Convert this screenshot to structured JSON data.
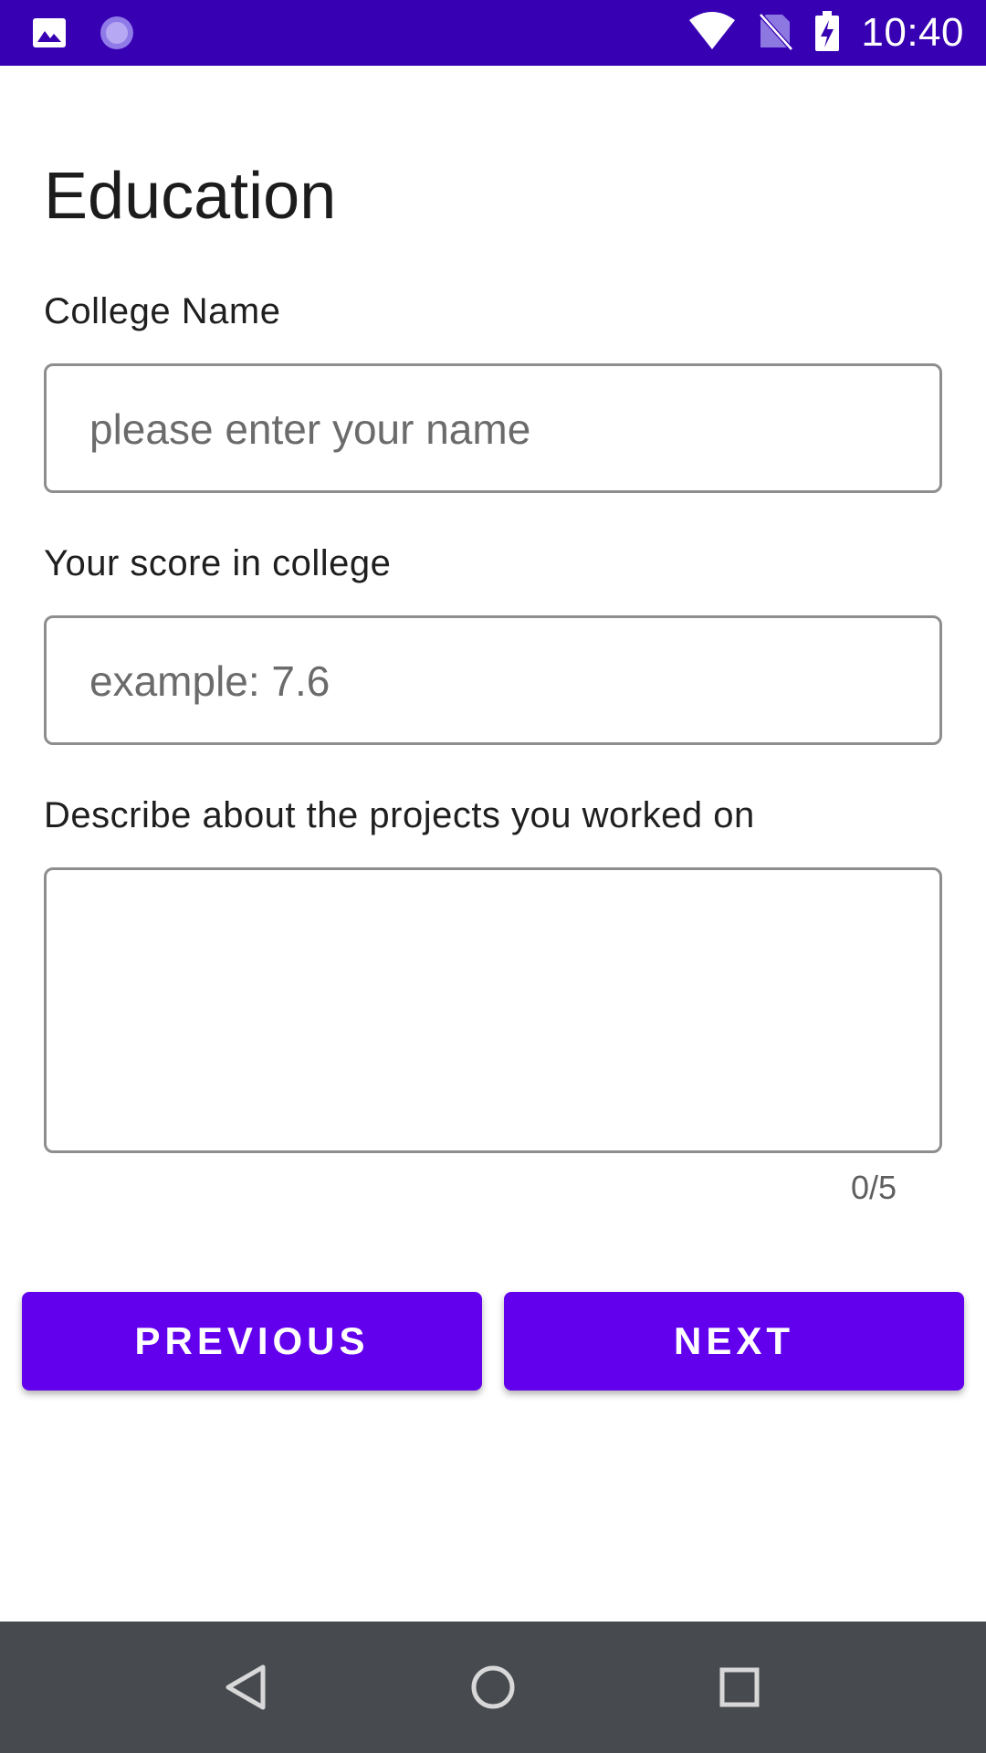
{
  "status_bar": {
    "time": "10:40",
    "icons": [
      "image-icon",
      "loading-icon",
      "wifi-icon",
      "no-sim-icon",
      "battery-charging-icon"
    ],
    "background": "#3700b3"
  },
  "page": {
    "title": "Education"
  },
  "fields": {
    "college_name": {
      "label": "College Name",
      "placeholder": "please enter your name",
      "value": ""
    },
    "score": {
      "label": "Your score in college",
      "placeholder": "example: 7.6",
      "value": ""
    },
    "projects": {
      "label": "Describe about the projects you worked on",
      "value": "",
      "counter": "0/5"
    }
  },
  "buttons": {
    "previous": "PREVIOUS",
    "next": "NEXT",
    "accent": "#6200ee"
  },
  "nav_bar": {
    "icons": [
      "back-icon",
      "home-icon",
      "recents-icon"
    ]
  }
}
